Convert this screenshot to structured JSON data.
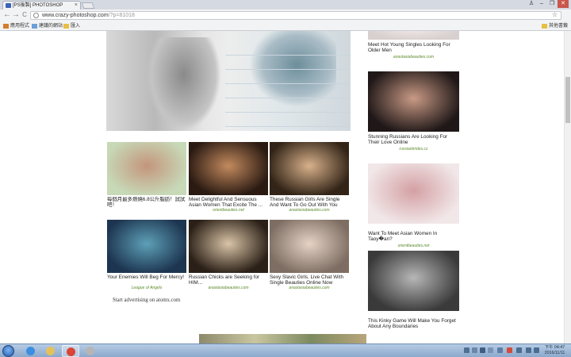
{
  "browser": {
    "tab_title": "[PS後製] PHOTOSHOP",
    "tab_close": "×",
    "url_host": "www.crazy-photoshop.com",
    "url_path": "/?p=81018",
    "back": "←",
    "forward": "→",
    "reload": "C",
    "star": "☆",
    "window_controls": [
      "♙",
      "–",
      "❐",
      "✕"
    ],
    "bookmarks": [
      {
        "label": "應用程式",
        "color": "#d77b2d"
      },
      {
        "label": "建議的網站",
        "color": "#6a9fd8"
      },
      {
        "label": "匯入",
        "color": "#e7bf43"
      }
    ],
    "other_bookmarks": "其他書籤"
  },
  "ads_grid": [
    {
      "title": "每個月最多燃燒6.8公斤脂肪！試試吧！",
      "source": "",
      "colors": [
        "#c7d9b7",
        "#c4957c"
      ]
    },
    {
      "title": "Meet Delightful And Sensuous Asian Women That Excite The ...",
      "source": "orientbeauties.net",
      "colors": [
        "#2a1a12",
        "#c38a5e"
      ]
    },
    {
      "title": "These Russian Girls Are Single And Want To Go Out With You",
      "source": "anastasiabeauties.com",
      "colors": [
        "#322417",
        "#d8b18b"
      ]
    },
    {
      "title": "Your Enemies Will Beg For Mercy!",
      "source": "League of Angels",
      "colors": [
        "#1d3550",
        "#5ea0b8"
      ]
    },
    {
      "title": "Russian Chicks are Seeking for HIM...",
      "source": "anastasiabeauties.com",
      "colors": [
        "#2b2017",
        "#d9c4a7"
      ]
    },
    {
      "title": "Sexy Slavic Girls. Live Chat With Single Beauties Online Now",
      "source": "anastasiabeauties.com",
      "colors": [
        "#7e6d62",
        "#e6d3c6"
      ]
    }
  ],
  "start_ad_text": "Start advertising on atomx.com",
  "sidebar_ads": [
    {
      "title": "Meet Hot Young Singles Looking For Older Men",
      "source": "anastasiabeauties.com",
      "colors": [
        "#d8d0cf",
        "#f4ebea"
      ]
    },
    {
      "title": "Stunning Russians Are Looking For Their Love Online",
      "source": "russianbrides.cz",
      "colors": [
        "#201818",
        "#c99a85"
      ]
    },
    {
      "title": "Want To Meet Asian Women In Taoy�an?",
      "source": "orientbeauties.net",
      "colors": [
        "#f1e7e8",
        "#d4a0a4"
      ]
    },
    {
      "title": "This Kinky Game Will Make You Forget About Any Boundaries",
      "source": "",
      "colors": [
        "#3a3a3a",
        "#b7b7b7"
      ]
    }
  ],
  "taskbar": {
    "apps": [
      {
        "name": "internet-explorer",
        "color": "#3d8ee0"
      },
      {
        "name": "file-explorer",
        "color": "#e5c15a"
      },
      {
        "name": "chrome",
        "color": "#db4437"
      },
      {
        "name": "paint",
        "color": "#b5b5b5"
      }
    ],
    "clock_time": "下午 04:47",
    "clock_date": "2016/11/11"
  }
}
